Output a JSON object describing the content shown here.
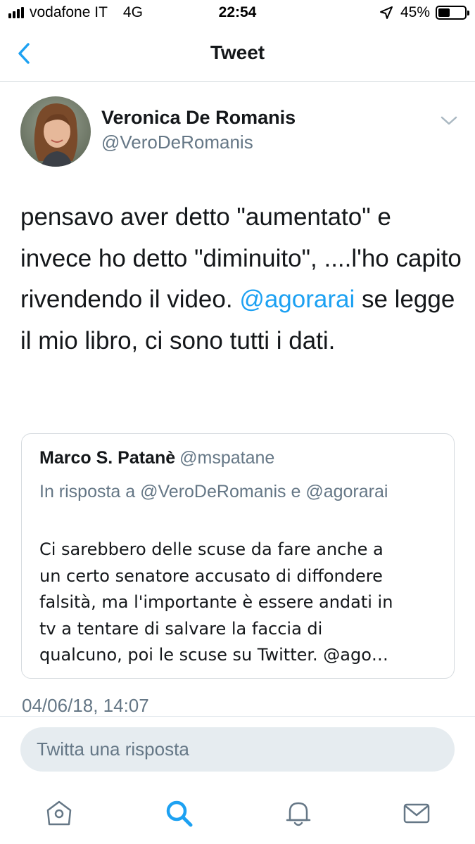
{
  "status_bar": {
    "carrier": "vodafone IT",
    "network": "4G",
    "time": "22:54",
    "battery": "45%",
    "battery_level": 0.45,
    "icons": [
      "signal-icon",
      "location-arrow-icon",
      "battery-icon"
    ]
  },
  "nav": {
    "title": "Tweet",
    "back_icon": "chevron-left-icon"
  },
  "tweet": {
    "author_name": "Veronica De Romanis",
    "author_handle": "@VeroDeRomanis",
    "text_before_mention": "pensavo aver detto \"aumentato\" e invece ho detto \"diminuito\", ....l'ho capito rivendendo il video. ",
    "mention": "@agorarai",
    "text_after_mention": " se legge il mio libro, ci sono tutti i dati.",
    "timestamp": "04/06/18, 14:07"
  },
  "quoted_tweet": {
    "author_name": "Marco S. Patanè",
    "author_handle": "@mspatane",
    "reply_context": "In risposta a @VeroDeRomanis e @agorarai",
    "text_lines": [
      "Ci sarebbero delle scuse da fare anche a",
      "un certo senatore accusato di diffondere",
      "falsità, ma l'importante è essere andati in",
      "tv a tentare di salvare la faccia di",
      "qualcuno, poi le scuse su Twitter. @ago…"
    ]
  },
  "reply": {
    "placeholder": "Twitta una risposta"
  },
  "tabbar": {
    "items": [
      "home-icon",
      "search-icon",
      "notifications-bell-icon",
      "messages-envelope-icon"
    ],
    "active_color": "#1da1f2",
    "inactive_color": "#657786"
  },
  "colors": {
    "accent": "#1da1f2",
    "secondary_text": "#657786",
    "primary_text": "#14171a"
  }
}
